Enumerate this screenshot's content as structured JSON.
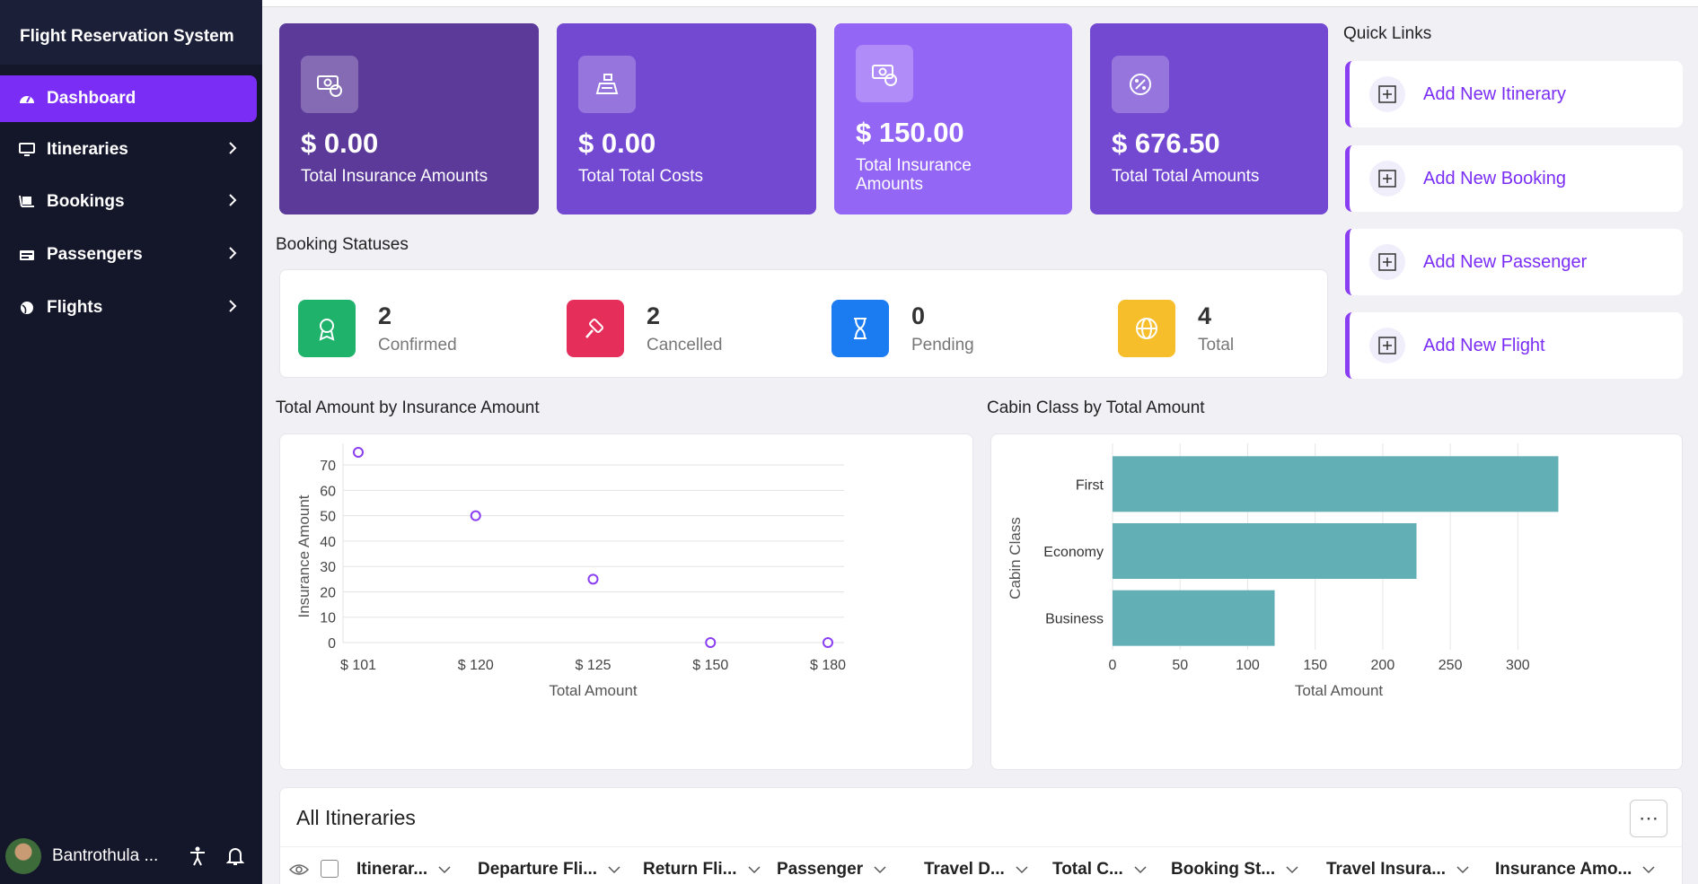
{
  "app": {
    "title": "Flight Reservation System"
  },
  "nav": [
    {
      "label": "Dashboard",
      "icon": "dashboard-icon",
      "active": true
    },
    {
      "label": "Itineraries",
      "icon": "monitor-icon"
    },
    {
      "label": "Bookings",
      "icon": "luggage-cart-icon"
    },
    {
      "label": "Passengers",
      "icon": "id-card-icon"
    },
    {
      "label": "Flights",
      "icon": "globe-icon"
    }
  ],
  "user": {
    "name": "Bantrothula ..."
  },
  "cards": [
    {
      "amount": "$ 0.00",
      "label": "Total Insurance Amounts",
      "color": "#5b3a9a",
      "icon": "money-icon"
    },
    {
      "amount": "$ 0.00",
      "label": "Total Total Costs",
      "color": "#7349d2",
      "icon": "cash-register-icon"
    },
    {
      "amount": "$ 150.00",
      "label": "Total Insurance Amounts",
      "color": "#9466f5",
      "icon": "money-icon"
    },
    {
      "amount": "$ 676.50",
      "label": "Total Total Amounts",
      "color": "#7349d2",
      "icon": "percent-icon"
    }
  ],
  "booking_statuses": {
    "title": "Booking Statuses",
    "items": [
      {
        "value": "2",
        "label": "Confirmed",
        "color": "#1fb26b",
        "icon": "award-icon"
      },
      {
        "value": "2",
        "label": "Cancelled",
        "color": "#e52f5a",
        "icon": "gavel-icon"
      },
      {
        "value": "0",
        "label": "Pending",
        "color": "#1b7cf2",
        "icon": "hourglass-icon"
      },
      {
        "value": "4",
        "label": "Total",
        "color": "#f7be2b",
        "icon": "globe-icon"
      }
    ]
  },
  "quick_links": {
    "title": "Quick Links",
    "items": [
      "Add New Itinerary",
      "Add New Booking",
      "Add New Passenger",
      "Add New Flight"
    ]
  },
  "chart_titles": {
    "scatter": "Total Amount by Insurance Amount",
    "bar": "Cabin Class by Total Amount"
  },
  "chart_data": [
    {
      "type": "scatter",
      "title": "Total Amount by Insurance Amount",
      "xlabel": "Total Amount",
      "ylabel": "Insurance Amount",
      "x_categories": [
        "$ 101",
        "$ 120",
        "$ 125",
        "$ 150",
        "$ 180"
      ],
      "y_ticks": [
        0,
        10,
        20,
        30,
        40,
        50,
        60,
        70
      ],
      "ylim": [
        0,
        75
      ],
      "points": [
        {
          "x": "$ 101",
          "y": 75
        },
        {
          "x": "$ 120",
          "y": 50
        },
        {
          "x": "$ 125",
          "y": 25
        },
        {
          "x": "$ 150",
          "y": 0
        },
        {
          "x": "$ 180",
          "y": 0
        }
      ],
      "marker_color": "#8a3ef2",
      "grid": true
    },
    {
      "type": "bar",
      "orientation": "horizontal",
      "title": "Cabin Class by Total Amount",
      "xlabel": "Total Amount",
      "ylabel": "Cabin Class",
      "categories": [
        "First",
        "Economy",
        "Business"
      ],
      "values": [
        330,
        225,
        120
      ],
      "x_ticks": [
        0,
        50,
        100,
        150,
        200,
        250,
        300
      ],
      "xlim": [
        0,
        335
      ],
      "bar_color": "#63afb6",
      "grid": true
    }
  ],
  "table": {
    "title": "All Itineraries",
    "columns": [
      "Itinerar...",
      "Departure Fli...",
      "Return Fli...",
      "Passenger",
      "Travel D...",
      "Total C...",
      "Booking St...",
      "Travel Insura...",
      "Insurance Amo..."
    ]
  }
}
